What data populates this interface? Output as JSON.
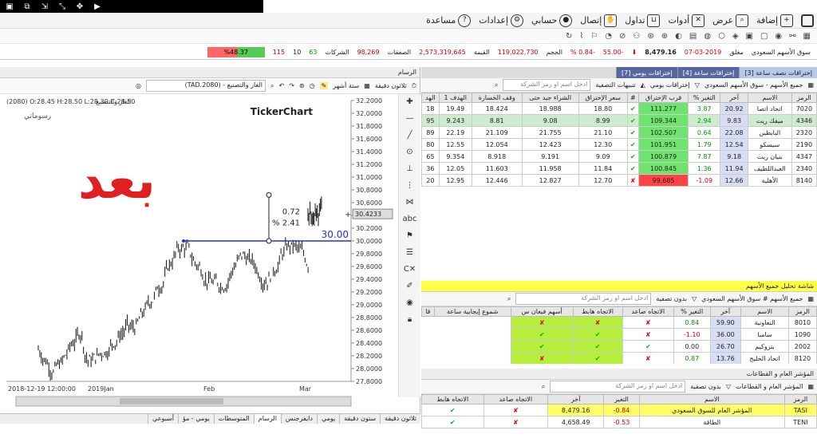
{
  "window": {
    "icons": [
      "▣",
      "⧉",
      "⇲",
      "⤡",
      "✥",
      "▶"
    ]
  },
  "menu": {
    "items": [
      "إضافة",
      "عرض",
      "أدوات",
      "تداول",
      "إتصال",
      "حسابي",
      "إعدادات",
      "مساعدة"
    ]
  },
  "status": {
    "market": "سوق الأسهم السعودي",
    "closed": "مغلق",
    "date": "07-03-2019",
    "index": "8,479.16",
    "change": "55.00-",
    "pct": "% 0.84-",
    "volume_lbl": "الحجم",
    "volume": "119,022,730",
    "value_lbl": "القيمة",
    "value": "2,573,319,645",
    "deals_lbl": "الصفقات",
    "deals": "98,269",
    "companies_lbl": "الشركات",
    "up": "63",
    "unch": "10",
    "down": "115",
    "bar": "%48.37"
  },
  "chart": {
    "panel_title": "الرسام",
    "tools": {
      "interval": "ثلاثون دقيقة",
      "period": "ستة أشهر",
      "symbol": "(TAD.2080) - الغاز والتصنيع"
    },
    "ohlc": "(2080) O:28.45 H:28.50 L:28.30 C:28.50",
    "owner": "الغاز والتصنيع",
    "brand": "TickerChart",
    "pattern_lbl": "رسوماتي",
    "big_text": "بعد",
    "level": "30.00",
    "last": "30.4233",
    "measure1": "0.72",
    "measure2": "% 2.41",
    "xdate": "2018-12-19 12:00:00",
    "xlabels": [
      "2019Jan",
      "Feb",
      "Mar"
    ],
    "yticks": [
      "32.2000",
      "32.0000",
      "31.8000",
      "31.6000",
      "31.4000",
      "31.2000",
      "31.0000",
      "30.8000",
      "30.6000",
      "30.4000",
      "30.2000",
      "30.0000",
      "29.8000",
      "29.6000",
      "29.4000",
      "29.2000",
      "29.0000",
      "28.8000",
      "28.6000",
      "28.4000",
      "28.2000",
      "28.0000",
      "27.8000"
    ]
  },
  "bottom": {
    "tabs": [
      "ثلاثون دقيقة",
      "ستون دقيقة",
      "يومي",
      "دايفرجنس",
      "الرسام",
      "المتوسطات",
      "يومي - مؤ",
      "أسبوعي"
    ]
  },
  "table1": {
    "tabs": [
      "إختراقات نصف ساعة [3]",
      "إختراقات ساعة [4]",
      "إختراقات يومي [7]"
    ],
    "filter": "جميع الأسهم - سوق الأسهم السعودي",
    "subtitle": "إختراقات يومي",
    "alerts": "تنبيهات التصفية",
    "placeholder": "ادخل اسم او رمز الشركة",
    "headers": [
      "الرمز",
      "الاسم",
      "آخر",
      "التغير %",
      "قرب الإختراق",
      "#",
      "سعر الإختراق",
      "الشراء جيد حتى",
      "وقف الخسارة",
      "الهدف 1",
      "الهد"
    ],
    "rows": [
      [
        "7020",
        "اتحاد اتصا",
        "20.92",
        "3.87",
        "111.277",
        "✔",
        "18.80",
        "18.988",
        "18.424",
        "19.49",
        "18"
      ],
      [
        "4346",
        "ميفك ريت",
        "9.83",
        "2.94",
        "109.344",
        "✔",
        "8.99",
        "9.08",
        "8.81",
        "9.243",
        "95"
      ],
      [
        "2320",
        "البابطين",
        "22.08",
        "0.64",
        "102.507",
        "✔",
        "21.10",
        "21.755",
        "21.109",
        "22.19",
        "89"
      ],
      [
        "2190",
        "سيسكو",
        "12.54",
        "1.79",
        "101.951",
        "✔",
        "12.30",
        "12.423",
        "12.054",
        "12.55",
        "80"
      ],
      [
        "4347",
        "بنيان ريت",
        "9.18",
        "7.87",
        "100.879",
        "✔",
        "9.09",
        "9.191",
        "8.918",
        "9.354",
        "65"
      ],
      [
        "2340",
        "العبداللطيف",
        "11.94",
        "1.36",
        "100.845",
        "✔",
        "11.84",
        "11.958",
        "11.603",
        "12.05",
        "36"
      ],
      [
        "8140",
        "الأهلية",
        "12.66",
        "1.09-",
        "99.685",
        "✘",
        "12.70",
        "12.827",
        "12.446",
        "12.95",
        "20"
      ]
    ]
  },
  "table2": {
    "title": "شاشة تحليل جميع الأسهم",
    "filter": "جميع الأسهم # سوق الأسهم السعودي",
    "nofilter": "بدون تصفية",
    "placeholder": "ادخل اسم او رمز الشركة",
    "headers": [
      "الرمز",
      "الاسم",
      "آخر",
      "التغير %",
      "الاتجاه صاعد",
      "الاتجاه هابط",
      "أسهم فيعان س",
      "شموع إيجابية ساعة",
      "قا"
    ],
    "rows": [
      [
        "8010",
        "التعاونية",
        "59.90",
        "0.84",
        "✘",
        "✘",
        "✘"
      ],
      [
        "1090",
        "سامبا",
        "36.00",
        "1.10-",
        "✘",
        "✔",
        "✔"
      ],
      [
        "2002",
        "بتروكيم",
        "26.70",
        "0.00",
        "✔",
        "✔",
        "✔"
      ],
      [
        "8120",
        "اتحاد الخليج",
        "13.76",
        "0.87",
        "✘",
        "✔",
        "✘"
      ]
    ]
  },
  "table3": {
    "title": "المؤشر العام و القطاعات",
    "filter": "المؤشر العام و القطاعات",
    "nofilter": "بدون تصفية",
    "placeholder": "ادخل اسم او رمز الشركة",
    "headers": [
      "الرمز",
      "الاسم",
      "التغير",
      "آخر",
      "الاتجاه صاعد",
      "الاتجاه هابط"
    ],
    "rows": [
      [
        "TASI",
        "المؤشر العام للسوق السعودي",
        "0.84-",
        "8,479.16",
        "✘",
        "✔"
      ],
      [
        "TENI",
        "الطاقة",
        "0.53-",
        "4,658.49",
        "✘",
        "✔"
      ]
    ]
  }
}
